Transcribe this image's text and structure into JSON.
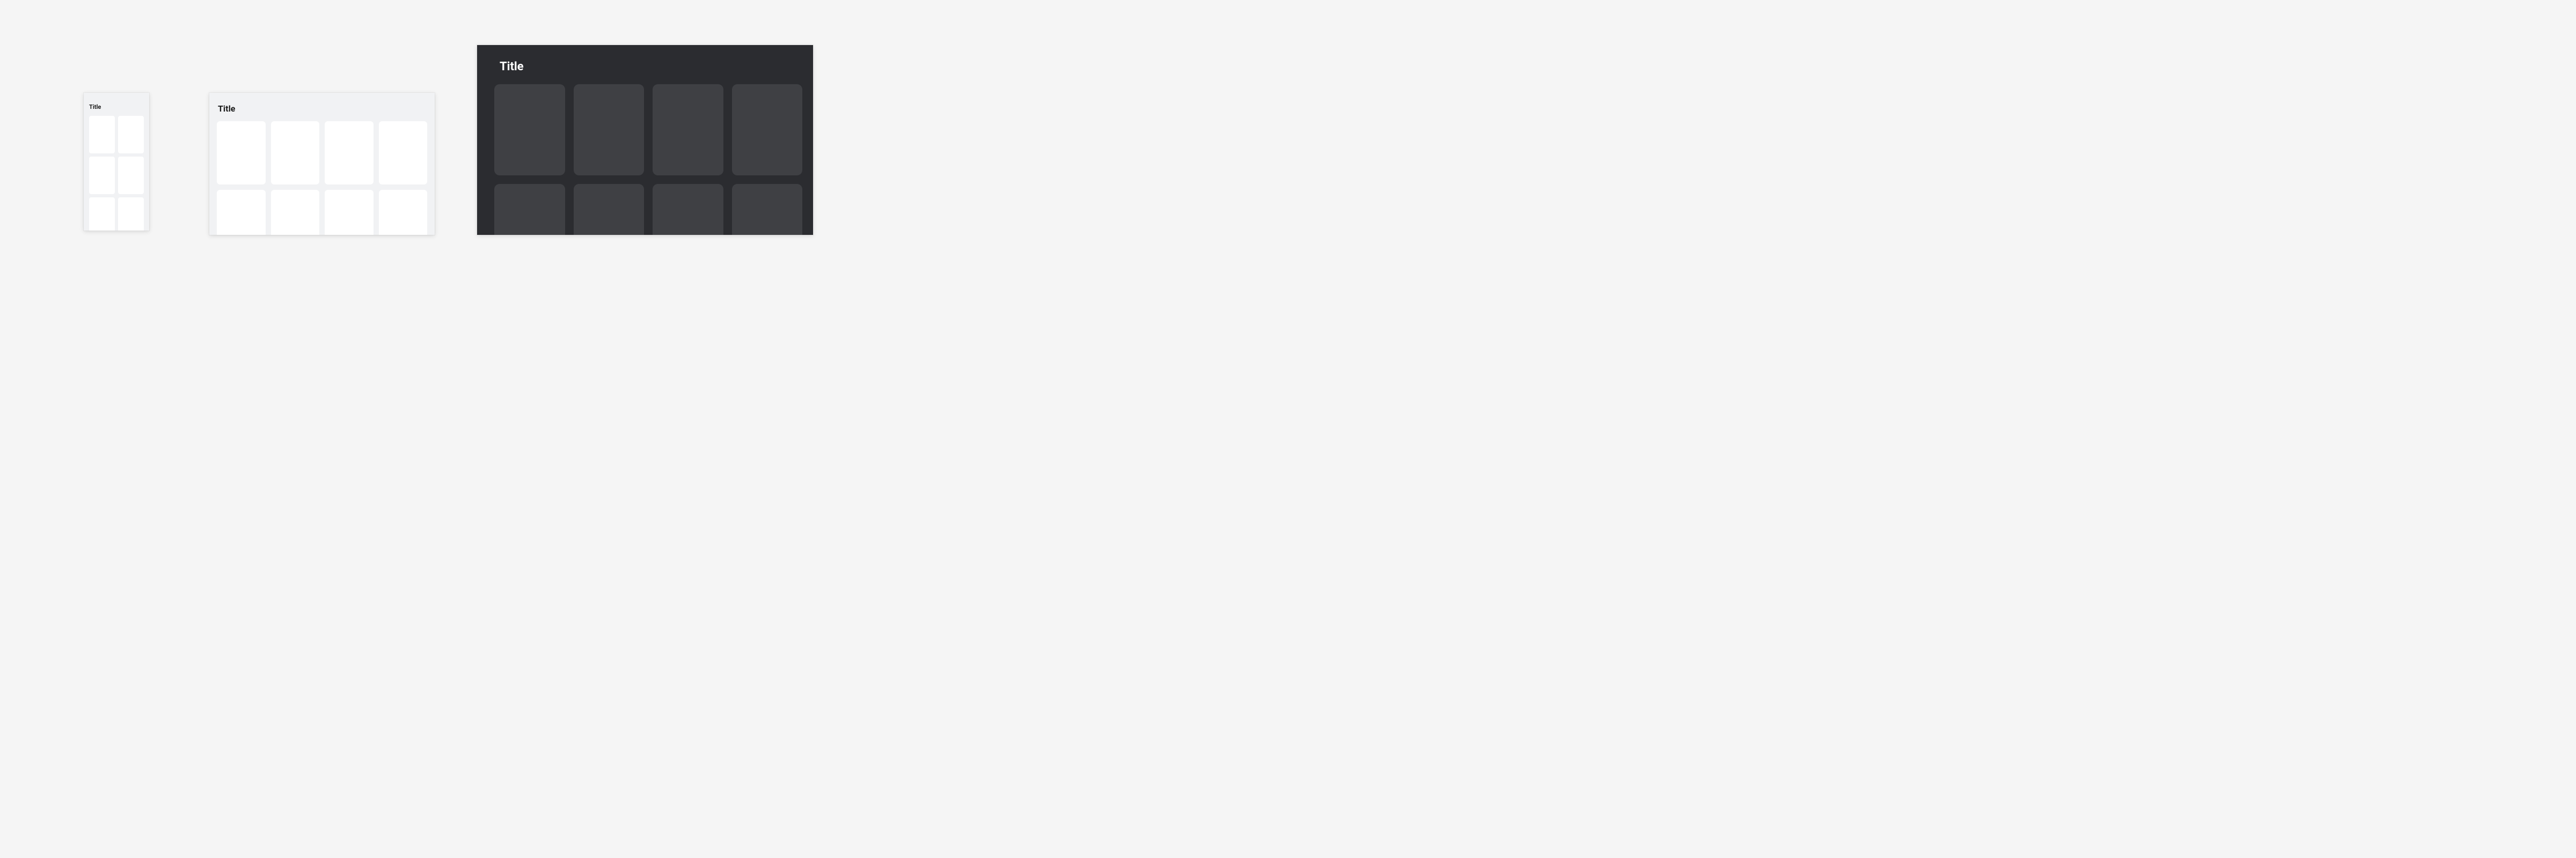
{
  "panels": {
    "small": {
      "title": "Title"
    },
    "medium": {
      "title": "Title"
    },
    "large": {
      "title": "Title"
    }
  }
}
